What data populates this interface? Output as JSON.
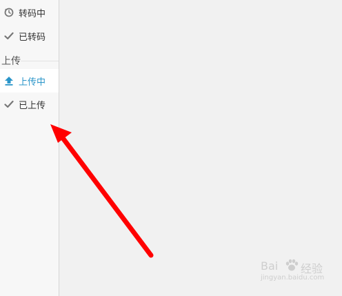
{
  "sidebar": {
    "transcode_items": [
      {
        "label": "转码中",
        "icon": "clock-sync-icon"
      },
      {
        "label": "已转码",
        "icon": "check-icon"
      }
    ],
    "upload_section_title": "上传",
    "upload_items": [
      {
        "label": "上传中",
        "icon": "upload-arrow-icon",
        "active": true
      },
      {
        "label": "已上传",
        "icon": "check-icon",
        "active": false
      }
    ]
  },
  "colors": {
    "accent": "#2a95c9",
    "arrow": "#ff0000",
    "sidebar_bg": "#f7f7f7",
    "main_bg": "#f1f1f1"
  },
  "watermark": {
    "brand": "Bai",
    "suffix": "经验",
    "url": "jingyan.baidu.com"
  }
}
